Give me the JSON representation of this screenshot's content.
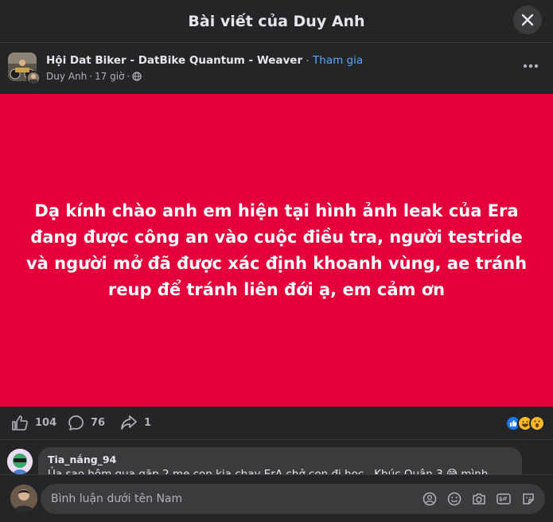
{
  "header": {
    "title": "Bài viết của Duy Anh",
    "close_icon": "close-icon"
  },
  "post": {
    "group_name": "Hội Dat Biker - DatBike Quantum - Weaver",
    "separator": "·",
    "join_label": "Tham gia",
    "author": "Duy Anh",
    "time": "17 giờ",
    "privacy_icon": "globe-icon",
    "image_text": "Dạ kính chào anh em hiện tại hình ảnh leak của Era đang được công an vào cuộc điều tra, người testride và người mở đã được xác định khoanh vùng, ae tránh reup để tránh liên đới ạ, em cảm ơn",
    "image_bg": "#e4003b"
  },
  "stats": {
    "likes": "104",
    "comments": "76",
    "shares": "1"
  },
  "comment": {
    "author": "Tia_nắng_94",
    "text": "Ủa sao hôm qua gặp 2 mẹ con kia chạy ErA chở con đi học , Khúc Quận 3 😅 mình"
  },
  "composer": {
    "placeholder": "Bình luận dưới tên Nam"
  },
  "colors": {
    "accent": "#5aa7ff",
    "background": "#242526",
    "surface": "#3a3b3c"
  }
}
